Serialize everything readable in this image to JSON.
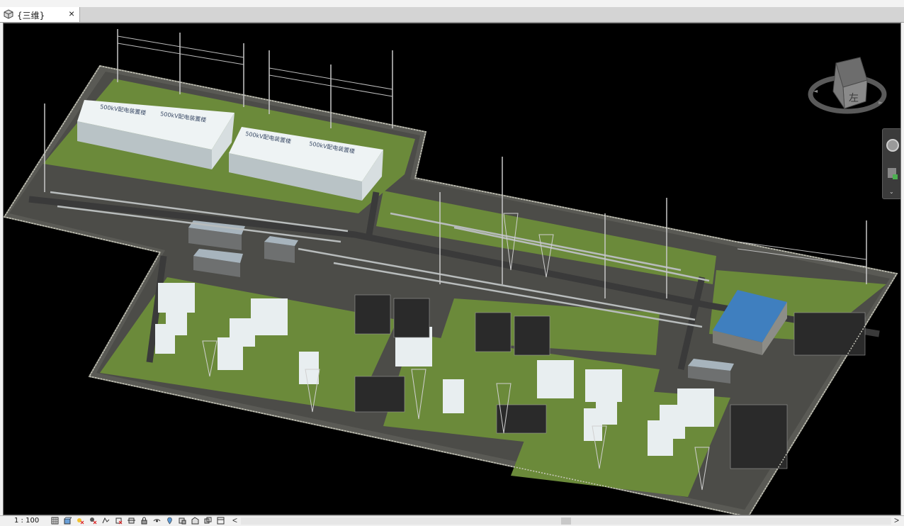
{
  "window": {
    "tab_title": "{三维}",
    "close_glyph": "×"
  },
  "viewcube": {
    "face_label": "左"
  },
  "scene": {
    "hall_labels": [
      "500kV配电装置楼",
      "500kV配电装置楼",
      "500kV配电装置楼",
      "500kV配电装置楼"
    ]
  },
  "statusbar": {
    "scale_text": "1 : 100",
    "scroll_left": "<",
    "scroll_right": ">"
  },
  "colors": {
    "background": "#000000",
    "grass": "#6b8a3a",
    "road": "#4a4a4a",
    "building_white": "#e8eef0",
    "roof_blue": "#3f7fbf"
  }
}
